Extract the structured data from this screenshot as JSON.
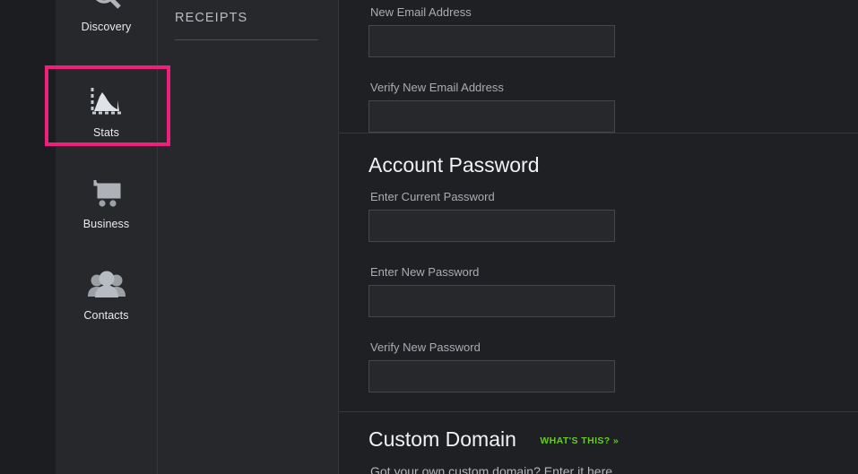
{
  "theme": {
    "bg_rail": "#1b1d20",
    "bg_sidebar": "#26282c",
    "bg_content": "#1e2023",
    "highlight": "#ef1f7b",
    "accent_green": "#66cc22",
    "divider": "#34373c",
    "input_bg": "#26282c",
    "input_border": "#44474c"
  },
  "sidebar": {
    "items": [
      {
        "label": "Discovery",
        "icon": "magnifier-icon",
        "selected": false
      },
      {
        "label": "Stats",
        "icon": "chart-icon",
        "selected": true
      },
      {
        "label": "Business",
        "icon": "shopping-cart-icon",
        "selected": false
      },
      {
        "label": "Contacts",
        "icon": "people-icon",
        "selected": false
      }
    ]
  },
  "midpanel": {
    "section_title": "RECEIPTS"
  },
  "main": {
    "email_section": {
      "fields": [
        {
          "label": "New Email Address",
          "value": "",
          "placeholder": ""
        },
        {
          "label": "Verify New Email Address",
          "value": "",
          "placeholder": ""
        }
      ]
    },
    "password_section": {
      "heading": "Account Password",
      "fields": [
        {
          "label": "Enter Current Password",
          "value": "",
          "placeholder": ""
        },
        {
          "label": "Enter New Password",
          "value": "",
          "placeholder": ""
        },
        {
          "label": "Verify New Password",
          "value": "",
          "placeholder": ""
        }
      ]
    },
    "domain_section": {
      "heading": "Custom Domain",
      "help_link": "WHAT'S THIS? »",
      "subtitle": "Got your own custom domain? Enter it here."
    }
  }
}
